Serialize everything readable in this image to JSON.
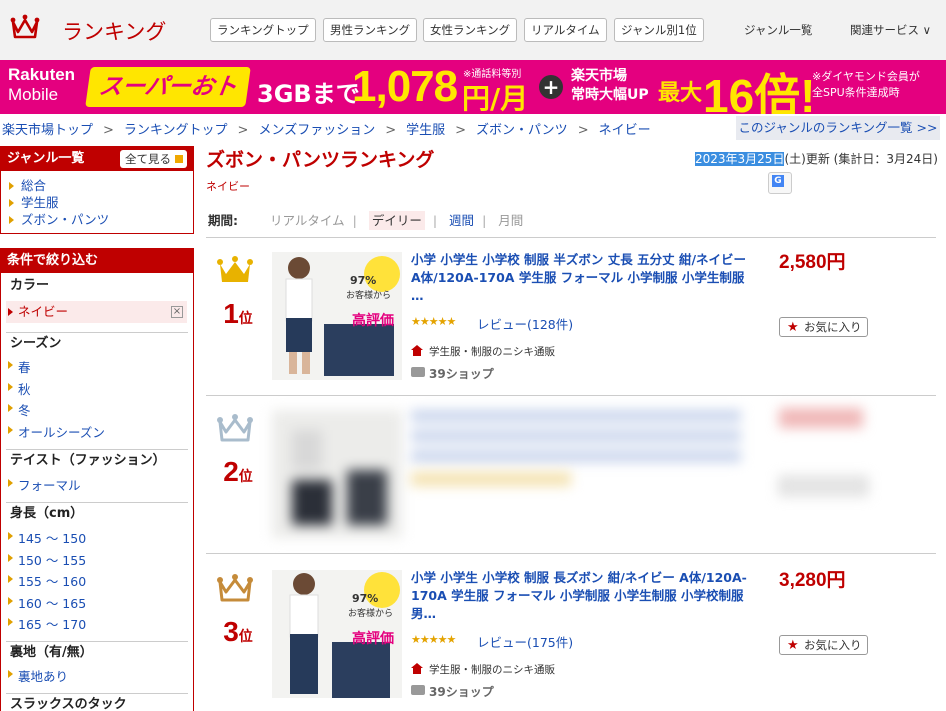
{
  "header": {
    "brand": "ランキング",
    "nav_buttons": [
      "ランキングトップ",
      "男性ランキング",
      "女性ランキング",
      "リアルタイム",
      "ジャンル別1位"
    ],
    "genre_list": "ジャンル一覧",
    "related_services": "関連サービス ∨"
  },
  "banner": {
    "rakuten": "Rakuten",
    "mobile": "Mobile",
    "super": "スーパーおトク",
    "gb": "3GBまで",
    "price": "1,078",
    "note1": "※通話料等別",
    "yen_month": "円/月",
    "plus": "+",
    "market1": "楽天市場",
    "market2": "常時大幅UP",
    "max": "最大",
    "times16": "16倍!",
    "note2a": "※ダイヤモンド会員が",
    "note2b": "全SPU条件達成時"
  },
  "breadcrumb": [
    "楽天市場トップ",
    "ランキングトップ",
    "メンズファッション",
    "学生服",
    "ズボン・パンツ",
    "ネイビー"
  ],
  "genre_ranking_link": "このジャンルのランキング一覧 >>",
  "sidebar": {
    "genre_head": "ジャンル一覧",
    "see_all": "全て見る",
    "genres": [
      "総合",
      "学生服",
      "ズボン・パンツ"
    ],
    "filter_head": "条件で絞り込む",
    "color_title": "カラー",
    "color_selected": "ネイビー",
    "season_title": "シーズン",
    "seasons": [
      "春",
      "秋",
      "冬",
      "オールシーズン"
    ],
    "taste_title": "テイスト（ファッション）",
    "tastes": [
      "フォーマル"
    ],
    "height_title": "身長（cm）",
    "heights": [
      "145 ～ 150",
      "150 ～ 155",
      "155 ～ 160",
      "160 ～ 165",
      "165 ～ 170"
    ],
    "lining_title": "裏地（有/無）",
    "linings": [
      "裏地あり"
    ],
    "slacks_title": "スラックスのタック"
  },
  "main": {
    "title": "ズボン・パンツランキング",
    "subtitle": "ネイビー",
    "updated_date": "2023年3月25日",
    "updated_rest": "(土)更新 (集計日：3月24日)",
    "period_label": "期間:",
    "period_opts": [
      "リアルタイム",
      "デイリー",
      "週間",
      "月間"
    ]
  },
  "items": [
    {
      "rank": "1",
      "rank_suffix": "位",
      "crown_color": "#e8b200",
      "title": "小学 小学生 小学校 制服 半ズボン 丈長 五分丈 紺/ネイビー A体/120A-170A 学生服 フォーマル 小学制服 小学生制服 …",
      "stars": "★★★★★",
      "review": "レビュー(128件)",
      "shop": "学生服・制服のニシキ通販",
      "ship": "39ショップ",
      "price": "2,580円",
      "fav": "お気に入り",
      "img_badge_pct": "97%",
      "img_badge_text": "お客様から",
      "img_badge_eval": "高評価"
    },
    {
      "rank": "2",
      "rank_suffix": "位",
      "crown_color": "#a9bccc"
    },
    {
      "rank": "3",
      "rank_suffix": "位",
      "crown_color": "#c58b3a",
      "title": "小学 小学生 小学校 制服 長ズボン 紺/ネイビー A体/120A-170A 学生服 フォーマル 小学制服 小学生制服 小学校制服 男…",
      "stars": "★★★★★",
      "review": "レビュー(175件)",
      "shop": "学生服・制服のニシキ通販",
      "ship": "39ショップ",
      "price": "3,280円",
      "fav": "お気に入り",
      "img_badge_pct": "97%",
      "img_badge_text": "お客様から",
      "img_badge_eval": "高評価"
    }
  ]
}
